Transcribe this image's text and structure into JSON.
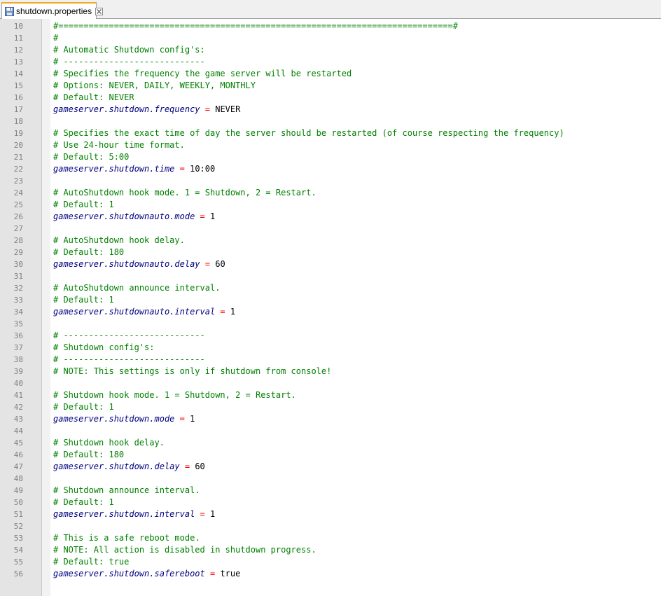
{
  "tab": {
    "label": "shutdown.properties",
    "file_icon": "save-disk-icon",
    "close_icon": "close-icon",
    "accent_color": "#f5a623"
  },
  "colors": {
    "comment": "#008000",
    "key": "#000080",
    "equals": "#ff0000",
    "value": "#000000",
    "line_number": "#808080"
  },
  "lines": [
    {
      "n": "10",
      "type": "comment",
      "text": "#==============================================================================#"
    },
    {
      "n": "11",
      "type": "comment",
      "text": "#"
    },
    {
      "n": "12",
      "type": "comment",
      "text": "# Automatic Shutdown config's:"
    },
    {
      "n": "13",
      "type": "comment",
      "text": "# ----------------------------"
    },
    {
      "n": "14",
      "type": "comment",
      "text": "# Specifies the frequency the game server will be restarted"
    },
    {
      "n": "15",
      "type": "comment",
      "text": "# Options: NEVER, DAILY, WEEKLY, MONTHLY"
    },
    {
      "n": "16",
      "type": "comment",
      "text": "# Default: NEVER"
    },
    {
      "n": "17",
      "type": "prop",
      "key": "gameserver.shutdown.frequency",
      "value": "NEVER"
    },
    {
      "n": "18",
      "type": "blank",
      "text": ""
    },
    {
      "n": "19",
      "type": "comment",
      "text": "# Specifies the exact time of day the server should be restarted (of course respecting the frequency)"
    },
    {
      "n": "20",
      "type": "comment",
      "text": "# Use 24-hour time format."
    },
    {
      "n": "21",
      "type": "comment",
      "text": "# Default: 5:00"
    },
    {
      "n": "22",
      "type": "prop",
      "key": "gameserver.shutdown.time",
      "value": "10:00"
    },
    {
      "n": "23",
      "type": "blank",
      "text": ""
    },
    {
      "n": "24",
      "type": "comment",
      "text": "# AutoShutdown hook mode. 1 = Shutdown, 2 = Restart."
    },
    {
      "n": "25",
      "type": "comment",
      "text": "# Default: 1"
    },
    {
      "n": "26",
      "type": "prop",
      "key": "gameserver.shutdownauto.mode",
      "value": "1"
    },
    {
      "n": "27",
      "type": "blank",
      "text": ""
    },
    {
      "n": "28",
      "type": "comment",
      "text": "# AutoShutdown hook delay."
    },
    {
      "n": "29",
      "type": "comment",
      "text": "# Default: 180"
    },
    {
      "n": "30",
      "type": "prop",
      "key": "gameserver.shutdownauto.delay",
      "value": "60"
    },
    {
      "n": "31",
      "type": "blank",
      "text": ""
    },
    {
      "n": "32",
      "type": "comment",
      "text": "# AutoShutdown announce interval."
    },
    {
      "n": "33",
      "type": "comment",
      "text": "# Default: 1"
    },
    {
      "n": "34",
      "type": "prop",
      "key": "gameserver.shutdownauto.interval",
      "value": "1"
    },
    {
      "n": "35",
      "type": "blank",
      "text": ""
    },
    {
      "n": "36",
      "type": "comment",
      "text": "# ----------------------------"
    },
    {
      "n": "37",
      "type": "comment",
      "text": "# Shutdown config's:"
    },
    {
      "n": "38",
      "type": "comment",
      "text": "# ----------------------------"
    },
    {
      "n": "39",
      "type": "comment",
      "text": "# NOTE: This settings is only if shutdown from console!"
    },
    {
      "n": "40",
      "type": "blank",
      "text": ""
    },
    {
      "n": "41",
      "type": "comment",
      "text": "# Shutdown hook mode. 1 = Shutdown, 2 = Restart."
    },
    {
      "n": "42",
      "type": "comment",
      "text": "# Default: 1"
    },
    {
      "n": "43",
      "type": "prop",
      "key": "gameserver.shutdown.mode",
      "value": "1"
    },
    {
      "n": "44",
      "type": "blank",
      "text": ""
    },
    {
      "n": "45",
      "type": "comment",
      "text": "# Shutdown hook delay."
    },
    {
      "n": "46",
      "type": "comment",
      "text": "# Default: 180"
    },
    {
      "n": "47",
      "type": "prop",
      "key": "gameserver.shutdown.delay",
      "value": "60"
    },
    {
      "n": "48",
      "type": "blank",
      "text": ""
    },
    {
      "n": "49",
      "type": "comment",
      "text": "# Shutdown announce interval."
    },
    {
      "n": "50",
      "type": "comment",
      "text": "# Default: 1"
    },
    {
      "n": "51",
      "type": "prop",
      "key": "gameserver.shutdown.interval",
      "value": "1"
    },
    {
      "n": "52",
      "type": "blank",
      "text": ""
    },
    {
      "n": "53",
      "type": "comment",
      "text": "# This is a safe reboot mode."
    },
    {
      "n": "54",
      "type": "comment",
      "text": "# NOTE: All action is disabled in shutdown progress."
    },
    {
      "n": "55",
      "type": "comment",
      "text": "# Default: true"
    },
    {
      "n": "56",
      "type": "prop",
      "key": "gameserver.shutdown.safereboot",
      "value": "true"
    }
  ]
}
